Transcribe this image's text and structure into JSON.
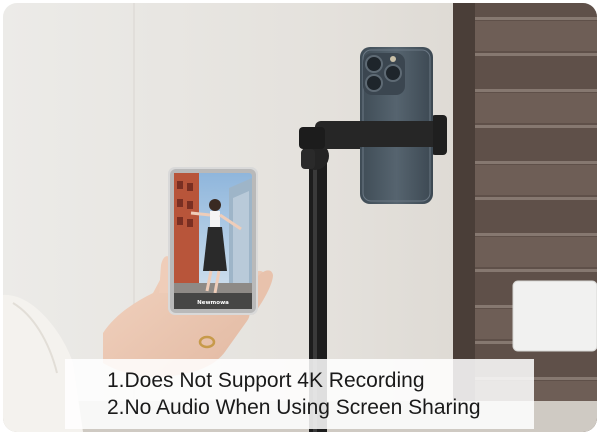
{
  "photo": {
    "subject": "product-photo",
    "screen_brand": "Newmowa"
  },
  "caption": {
    "line1": "1.Does Not Support 4K Recording",
    "line2": "2.No Audio When Using Screen Sharing"
  },
  "colors": {
    "wall": "#e6e3de",
    "shutter": "#5e4f47",
    "phone": "#4b5863",
    "stand": "#1c1c1c",
    "caption_bg": "#ffffff",
    "caption_text": "#1a1a1a"
  }
}
